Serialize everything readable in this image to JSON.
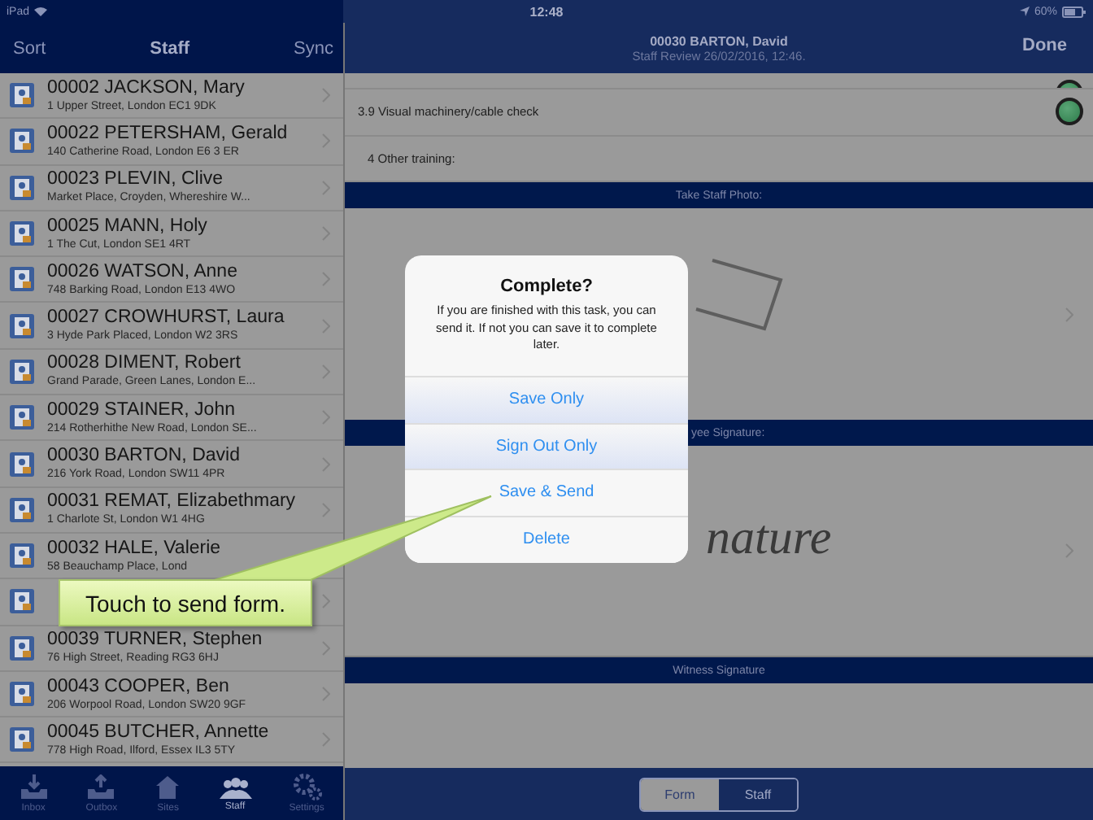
{
  "status_bar": {
    "device": "iPad",
    "time": "12:48",
    "battery": "60%"
  },
  "staff_panel": {
    "left_button": "Sort",
    "title": "Staff",
    "right_button": "Sync",
    "rows": [
      {
        "kind": "person",
        "name": "00002 JACKSON, Mary",
        "address": "1 Upper Street, London EC1 9DK"
      },
      {
        "kind": "person",
        "name": "00022 PETERSHAM, Gerald",
        "address": "140 Catherine Road, London E6 3 ER"
      },
      {
        "kind": "person",
        "name": "00023 PLEVIN, Clive",
        "address": "Market Place, Croyden, Whereshire W..."
      },
      {
        "kind": "person",
        "name": "00025 MANN, Holy",
        "address": "1 The Cut, London SE1 4RT"
      },
      {
        "kind": "person",
        "name": "00026 WATSON, Anne",
        "address": "748 Barking Road, London E13 4WO"
      },
      {
        "kind": "person",
        "name": "00027 CROWHURST, Laura",
        "address": "3 Hyde Park Placed, London W2 3RS"
      },
      {
        "kind": "person",
        "name": "00028 DIMENT, Robert",
        "address": "Grand Parade, Green Lanes, London E..."
      },
      {
        "kind": "person",
        "name": "00029 STAINER, John",
        "address": "214 Rotherhithe New Road, London SE..."
      },
      {
        "kind": "person",
        "name": "00030 BARTON, David",
        "address": "216 York Road, London SW11 4PR"
      },
      {
        "kind": "person",
        "name": "00031 REMAT, Elizabethmary",
        "address": "1 Charlote St, London W1 4HG"
      },
      {
        "kind": "person",
        "name": "00032 HALE, Valerie",
        "address": "58 Beauchamp Place, Lond"
      },
      {
        "kind": "covered"
      },
      {
        "kind": "person",
        "name": "00039 TURNER, Stephen",
        "address": "76 High Street, Reading RG3 6HJ"
      },
      {
        "kind": "person",
        "name": "00043 COOPER, Ben",
        "address": "206 Worpool Road, London SW20 9GF"
      },
      {
        "kind": "person",
        "name": "00045 BUTCHER, Annette",
        "address": "778 High Road, Ilford, Essex IL3 5TY"
      }
    ],
    "tabs": [
      {
        "kind": "inbox",
        "label": "Inbox",
        "selected": false
      },
      {
        "kind": "outbox",
        "label": "Outbox",
        "selected": false
      },
      {
        "kind": "sites",
        "label": "Sites",
        "selected": false
      },
      {
        "kind": "staff",
        "label": "Staff",
        "selected": true
      },
      {
        "kind": "settings",
        "label": "Settings",
        "selected": false
      }
    ]
  },
  "form_panel": {
    "title": "00030 BARTON, David",
    "subtitle": "Staff Review 26/02/2016, 12:46.",
    "done_button": "Done",
    "rows": [
      {
        "kind": "check",
        "checked": true
      },
      {
        "kind": "check",
        "label": "3.9 Visual machinery/cable check",
        "checked": true
      },
      {
        "kind": "text",
        "label": "4 Other training:"
      }
    ],
    "photo_section": "Take Staff Photo:",
    "employee_section": "yee Signature:",
    "signature_placeholder": "nature",
    "witness_section": "Witness Signature",
    "segments": [
      {
        "label": "Form",
        "selected": true
      },
      {
        "label": "Staff",
        "selected": false
      }
    ]
  },
  "dialog": {
    "title": "Complete?",
    "message": "If you are finished with this task, you can send it.  If not you can save it to complete later.",
    "actions": [
      {
        "label": "Save Only",
        "highlighted": true
      },
      {
        "label": "Sign Out Only",
        "highlighted": true
      },
      {
        "label": "Save & Send",
        "highlighted": false
      },
      {
        "label": "Delete",
        "highlighted": false
      }
    ]
  },
  "callout": {
    "text": "Touch to send form."
  }
}
